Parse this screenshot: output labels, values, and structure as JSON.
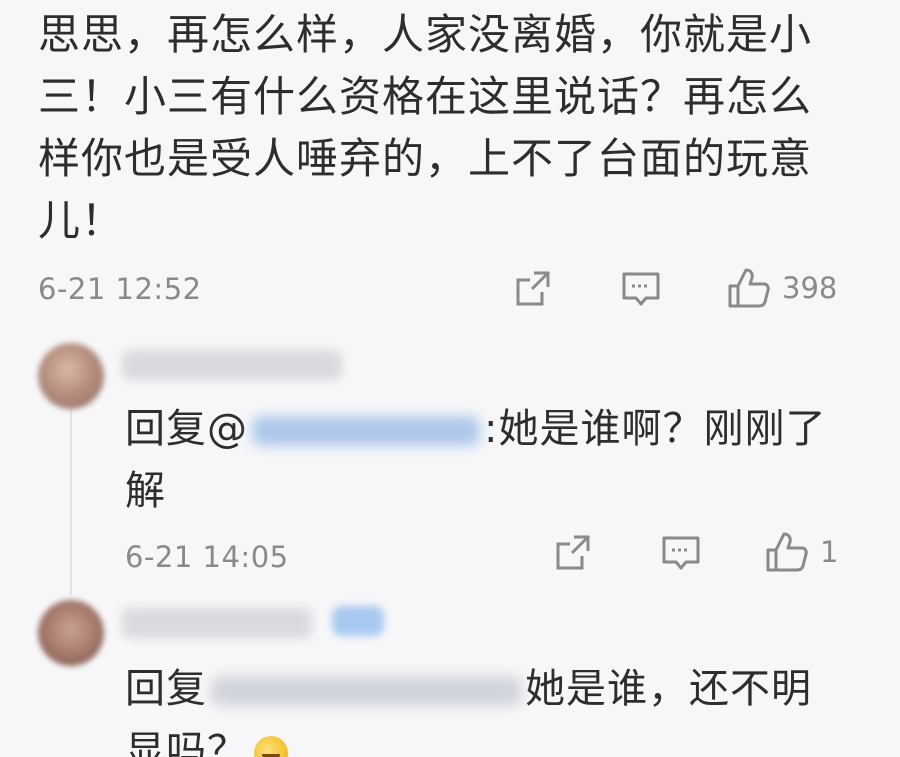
{
  "main_comment": {
    "text": "思思，再怎么样，人家没离婚，你就是小三！小三有什么资格在这里说话？再怎么样你也是受人唾弃的，上不了台面的玩意儿！",
    "time": "6-21 12:52",
    "like_count": "398",
    "icons": [
      "share-icon",
      "comment-icon",
      "like-icon"
    ]
  },
  "replies": [
    {
      "prefix": "回复@",
      "text": ":她是谁啊？刚刚了解",
      "time": "6-21 14:05",
      "like_count": "1"
    },
    {
      "prefix": "回复",
      "text": "她是谁，还不明显吗？",
      "emoji": "laughing-emoji"
    }
  ],
  "colors": {
    "background": "#f7f7f9",
    "text": "#2d2d2d",
    "meta": "#8a8a8a"
  }
}
